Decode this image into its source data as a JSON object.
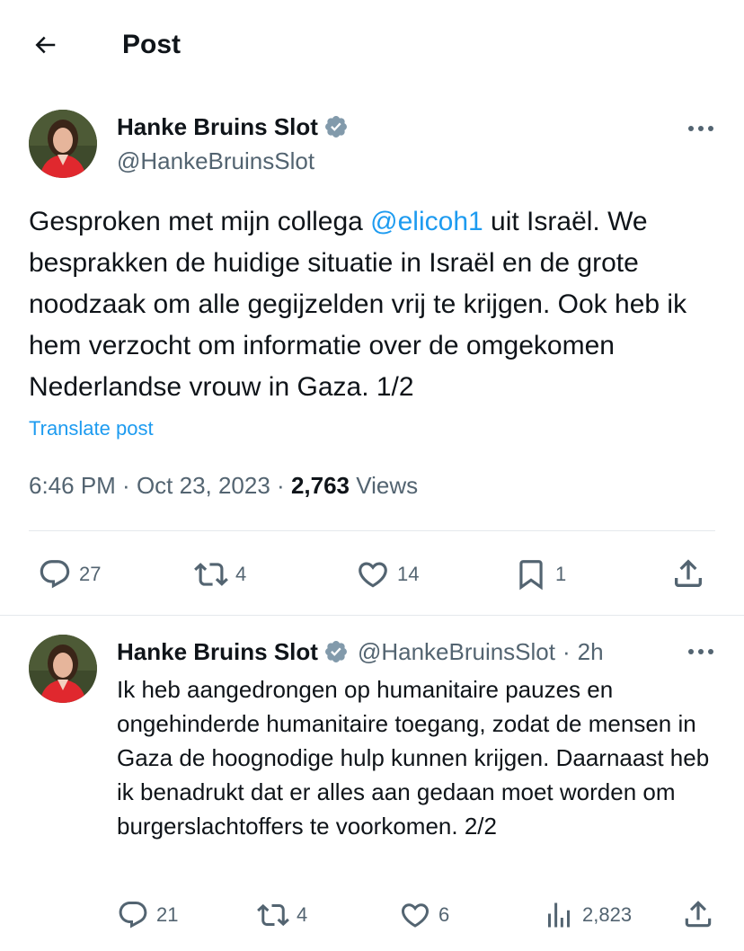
{
  "header": {
    "back_icon": "arrow-left-icon",
    "title": "Post"
  },
  "main_post": {
    "display_name": "Hanke Bruins Slot",
    "handle": "@HankeBruinsSlot",
    "text_before_mention": "Gesproken met mijn collega ",
    "mention": "@elicoh1",
    "text_after_mention": " uit Israël. We besprakken de huidige situatie in Israël en de grote noodzaak om alle gegijzelden vrij te krijgen. Ook heb ik hem verzocht om informatie over de omgekomen Nederlandse vrouw in Gaza. 1/2",
    "translate_label": "Translate post",
    "time": "6:46 PM",
    "date": "Oct 23, 2023",
    "views_count": "2,763",
    "views_label": "Views",
    "actions": {
      "replies": "27",
      "reposts": "4",
      "likes": "14",
      "bookmarks": "1"
    }
  },
  "reply_post": {
    "display_name": "Hanke Bruins Slot",
    "handle": "@HankeBruinsSlot",
    "time_ago": "2h",
    "text": "Ik heb aangedrongen op humanitaire pauzes en ongehinderde humanitaire toegang, zodat de mensen in Gaza de hoognodige hulp kunnen krijgen. Daarnaast heb ik benadrukt dat er alles aan gedaan moet worden om burgerslachtoffers te voorkomen. 2/2",
    "actions": {
      "replies": "21",
      "reposts": "4",
      "likes": "6",
      "views": "2,823"
    }
  },
  "colors": {
    "accent": "#1d9bf0",
    "muted": "#536471",
    "text": "#0f1419",
    "divider": "#e5e9ec"
  }
}
